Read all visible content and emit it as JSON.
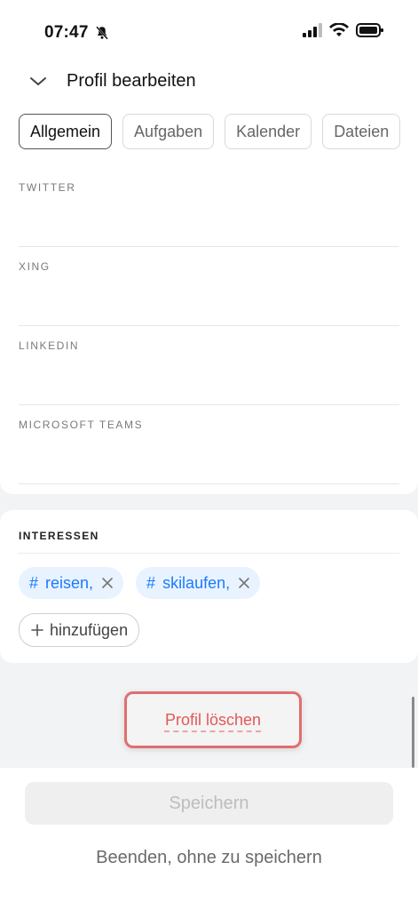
{
  "status": {
    "time": "07:47"
  },
  "header": {
    "title": "Profil bearbeiten"
  },
  "tabs": [
    {
      "label": "Allgemein",
      "active": true
    },
    {
      "label": "Aufgaben",
      "active": false
    },
    {
      "label": "Kalender",
      "active": false
    },
    {
      "label": "Dateien",
      "active": false
    }
  ],
  "social_fields": [
    {
      "label": "TWITTER",
      "value": ""
    },
    {
      "label": "XING",
      "value": ""
    },
    {
      "label": "LINKEDIN",
      "value": ""
    },
    {
      "label": "MICROSOFT TEAMS",
      "value": ""
    }
  ],
  "interests": {
    "title": "INTERESSEN",
    "tags": [
      {
        "label": "reisen,"
      },
      {
        "label": "skilaufen,"
      }
    ],
    "hash_symbol": "#",
    "add_label": "hinzufügen"
  },
  "actions": {
    "delete_label": "Profil löschen",
    "save_label": "Speichern",
    "exit_label": "Beenden, ohne zu speichern"
  },
  "colors": {
    "accent_blue": "#1c7bff",
    "delete_red": "#e45757",
    "highlight_border": "#e06f6f"
  },
  "icons": {
    "bell_muted": "bell-slash-icon",
    "signal": "signal-icon",
    "wifi": "wifi-icon",
    "battery": "battery-icon",
    "chevron": "chevron-down-icon",
    "remove": "close-icon",
    "add": "plus-icon"
  }
}
